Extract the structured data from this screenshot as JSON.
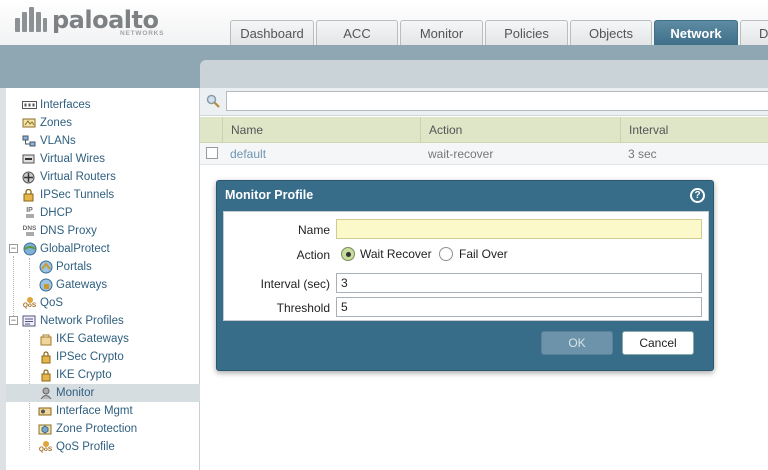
{
  "header": {
    "logo_text": "paloalto",
    "logo_sub": "NETWORKS",
    "tabs": [
      {
        "label": "Dashboard"
      },
      {
        "label": "ACC"
      },
      {
        "label": "Monitor"
      },
      {
        "label": "Policies"
      },
      {
        "label": "Objects"
      },
      {
        "label": "Network"
      },
      {
        "label": "De"
      }
    ],
    "active_tab": "Network"
  },
  "sidebar": {
    "items": [
      {
        "label": "Interfaces",
        "icon": "interfaces-icon"
      },
      {
        "label": "Zones",
        "icon": "zones-icon"
      },
      {
        "label": "VLANs",
        "icon": "vlans-icon"
      },
      {
        "label": "Virtual Wires",
        "icon": "virtual-wires-icon"
      },
      {
        "label": "Virtual Routers",
        "icon": "virtual-routers-icon"
      },
      {
        "label": "IPSec Tunnels",
        "icon": "ipsec-tunnels-icon"
      },
      {
        "label": "DHCP",
        "icon": "dhcp-icon"
      },
      {
        "label": "DNS Proxy",
        "icon": "dns-proxy-icon"
      },
      {
        "label": "GlobalProtect",
        "icon": "globalprotect-icon"
      },
      {
        "label": "Portals",
        "icon": "portals-icon"
      },
      {
        "label": "Gateways",
        "icon": "gateways-icon"
      },
      {
        "label": "QoS",
        "icon": "qos-icon"
      },
      {
        "label": "Network Profiles",
        "icon": "network-profiles-icon"
      },
      {
        "label": "IKE Gateways",
        "icon": "ike-gateways-icon"
      },
      {
        "label": "IPSec Crypto",
        "icon": "lock-icon"
      },
      {
        "label": "IKE Crypto",
        "icon": "lock-icon"
      },
      {
        "label": "Monitor",
        "icon": "monitor-icon"
      },
      {
        "label": "Interface Mgmt",
        "icon": "interface-mgmt-icon"
      },
      {
        "label": "Zone Protection",
        "icon": "zone-protection-icon"
      },
      {
        "label": "QoS Profile",
        "icon": "qos-profile-icon"
      }
    ],
    "selected": "Monitor",
    "icon_text": {
      "ip": "IP",
      "dns": "DNS",
      "qos": "QoS"
    }
  },
  "table": {
    "search_value": "",
    "columns": [
      "Name",
      "Action",
      "Interval"
    ],
    "rows": [
      {
        "name": "default",
        "action": "wait-recover",
        "interval": "3 sec"
      }
    ]
  },
  "modal": {
    "title": "Monitor Profile",
    "help_glyph": "?",
    "fields": {
      "name_label": "Name",
      "name_value": "",
      "action_label": "Action",
      "action_options": [
        "Wait Recover",
        "Fail Over"
      ],
      "action_selected": "Wait Recover",
      "interval_label": "Interval (sec)",
      "interval_value": "3",
      "threshold_label": "Threshold",
      "threshold_value": "5"
    },
    "buttons": {
      "ok": "OK",
      "cancel": "Cancel"
    }
  },
  "colors": {
    "brand_blue": "#386d8a",
    "active_tab": "#4a7a94",
    "table_header": "#dfe6c8",
    "required_field": "#fbf8c9",
    "link_text": "#2f5f7f"
  }
}
